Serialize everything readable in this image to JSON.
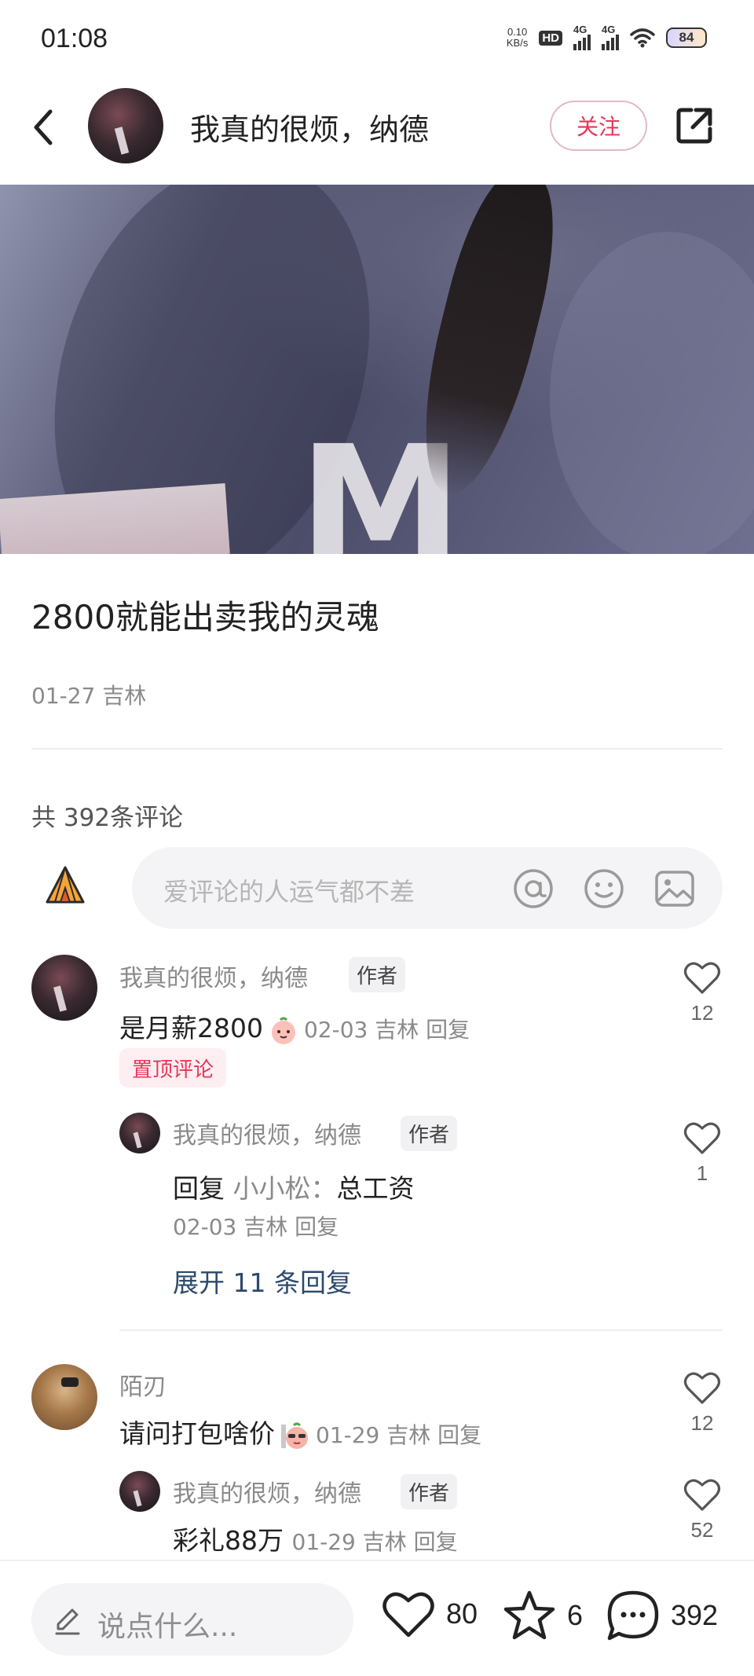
{
  "status_bar": {
    "time": "01:08",
    "net_speed_value": "0.10",
    "net_speed_unit": "KB/s",
    "hd_label": "HD",
    "signal_1_label": "4G",
    "signal_2_label": "4G",
    "battery": "84"
  },
  "header": {
    "author_name": "我真的很烦，纳德",
    "follow_label": "关注"
  },
  "post": {
    "title": "2800就能出卖我的灵魂",
    "meta": "01-27 吉林",
    "comment_count": "共 392条评论"
  },
  "comment_input": {
    "placeholder": "爱评论的人运气都不差"
  },
  "comments": [
    {
      "name": "我真的很烦，纳德",
      "author_tag": "作者",
      "text": "是月薪2800",
      "meta": "02-03 吉林 回复",
      "pinned_label": "置顶评论",
      "likes": "12",
      "reply": {
        "name": "我真的很烦，纳德",
        "author_tag": "作者",
        "prefix": "回复",
        "reply_to": "小小松：",
        "text": "总工资",
        "meta": "02-03 吉林 回复",
        "likes": "1"
      },
      "expand_label": "展开 11 条回复"
    },
    {
      "name": "陌刃",
      "text": "请问打包啥价",
      "meta": "01-29 吉林 回复",
      "likes": "12",
      "reply": {
        "name": "我真的很烦，纳德",
        "author_tag": "作者",
        "text": "彩礼88万",
        "meta": "01-29 吉林 回复",
        "likes": "52"
      }
    }
  ],
  "bottom_bar": {
    "say_placeholder": "说点什么...",
    "like_count": "80",
    "star_count": "6",
    "comment_count": "392"
  },
  "colors": {
    "accent_red": "#e8375a",
    "text_primary": "#222222",
    "text_secondary": "#8a8a8a",
    "link_blue": "#2d4a6b"
  },
  "icons": [
    "back-arrow-icon",
    "share-icon",
    "tent-icon",
    "at-icon",
    "smile-icon",
    "image-icon",
    "heart-icon",
    "star-icon",
    "comment-bubble-icon",
    "pencil-icon",
    "wifi-icon"
  ]
}
